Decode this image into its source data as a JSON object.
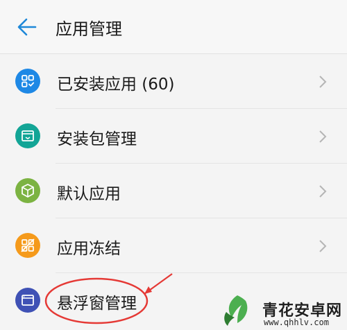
{
  "header": {
    "back_icon": "arrow-left-icon",
    "title": "应用管理",
    "accent_color": "#1e88d8"
  },
  "menu": {
    "items": [
      {
        "label": "已安装应用 (60)",
        "icon": "installed-apps-icon",
        "color": "#1e88e5"
      },
      {
        "label": "安装包管理",
        "icon": "package-icon",
        "color": "#13a596"
      },
      {
        "label": "默认应用",
        "icon": "cube-icon",
        "color": "#7cb342"
      },
      {
        "label": "应用冻结",
        "icon": "freeze-icon",
        "color": "#f59a1b"
      },
      {
        "label": "悬浮窗管理",
        "icon": "window-icon",
        "color": "#3f51b5"
      }
    ]
  },
  "annotation": {
    "circle_color": "#e53935",
    "target": "悬浮窗管理"
  },
  "watermark": {
    "title": "青花安卓网",
    "url": "www.qhhlv.com"
  }
}
